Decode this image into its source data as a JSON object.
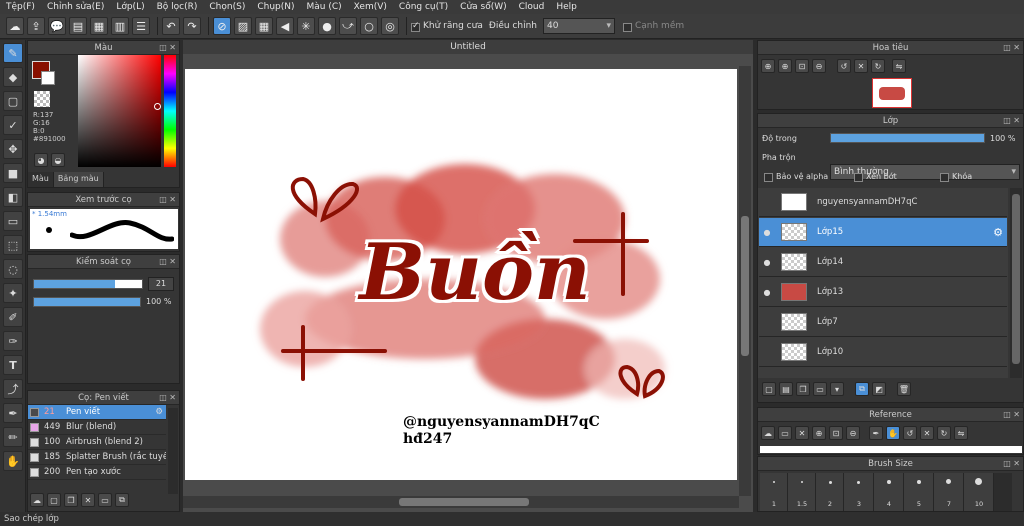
{
  "menu": [
    "Tệp(F)",
    "Chỉnh sửa(E)",
    "Lớp(L)",
    "Bộ lọc(R)",
    "Chọn(S)",
    "Chụp(N)",
    "Màu (C)",
    "Xem(V)",
    "Công cụ(T)",
    "Cửa sổ(W)",
    "Cloud",
    "Help"
  ],
  "toolbar": {
    "antialias_label": "Khử răng cưa",
    "adjust_label": "Điều chỉnh",
    "adjust_value": "40",
    "smooth_label": "Cạnh mềm"
  },
  "color_panel": {
    "title": "Màu",
    "r": "R:137",
    "g": "G:16",
    "b": "B:0",
    "hex": "#891000",
    "tab_color": "Màu",
    "tab_palette": "Bảng màu",
    "fg_color": "#891000"
  },
  "brush_preview": {
    "title": "Xem trước cọ",
    "size": "* 1.54mm"
  },
  "brush_control": {
    "title": "Kiểm soát cọ",
    "size_value": "21",
    "size_fraction": 0.75,
    "opacity_value": "100 %",
    "opacity_fraction": 1.0
  },
  "brush_list": {
    "title": "Cọ: Pen viết",
    "items": [
      {
        "num": "21",
        "name": "Pen viết",
        "color": "#4a4a4a"
      },
      {
        "num": "449",
        "name": "Blur (blend)",
        "color": "#e8a6e8"
      },
      {
        "num": "100",
        "name": "Airbrush (blend 2)",
        "color": "#dddddd"
      },
      {
        "num": "185",
        "name": "Splatter Brush (rắc tuyế",
        "color": "#dddddd"
      },
      {
        "num": "200",
        "name": "Pen tạo xước",
        "color": "#dddddd"
      }
    ]
  },
  "canvas": {
    "doc_title": "Untitled",
    "artwork_text": "Buồn",
    "watermark_line1": "@nguyensyannamDH7qC",
    "watermark_line2": "hđ247"
  },
  "navigator": {
    "title": "Hoa tiêu"
  },
  "layers": {
    "title": "Lớp",
    "opacity_label": "Độ trong",
    "opacity_value": "100 %",
    "opacity_fraction": 1.0,
    "blend_label": "Pha trộn",
    "blend_value": "Bình thường",
    "protect_alpha": "Bảo vệ alpha",
    "clipping": "Xén bớt",
    "lock": "Khóa",
    "items": [
      {
        "name": "nguyensyannamDH7qC",
        "visible": false
      },
      {
        "name": "Lớp15",
        "visible": true
      },
      {
        "name": "Lớp14",
        "visible": true
      },
      {
        "name": "Lớp13",
        "visible": true
      },
      {
        "name": "Lớp7",
        "visible": false
      },
      {
        "name": "Lớp10",
        "visible": false
      }
    ]
  },
  "reference": {
    "title": "Reference"
  },
  "brush_size": {
    "title": "Brush Size",
    "sizes": [
      "1",
      "1.5",
      "2",
      "3",
      "4",
      "5",
      "7",
      "10"
    ]
  },
  "status": "Sao chép lớp"
}
